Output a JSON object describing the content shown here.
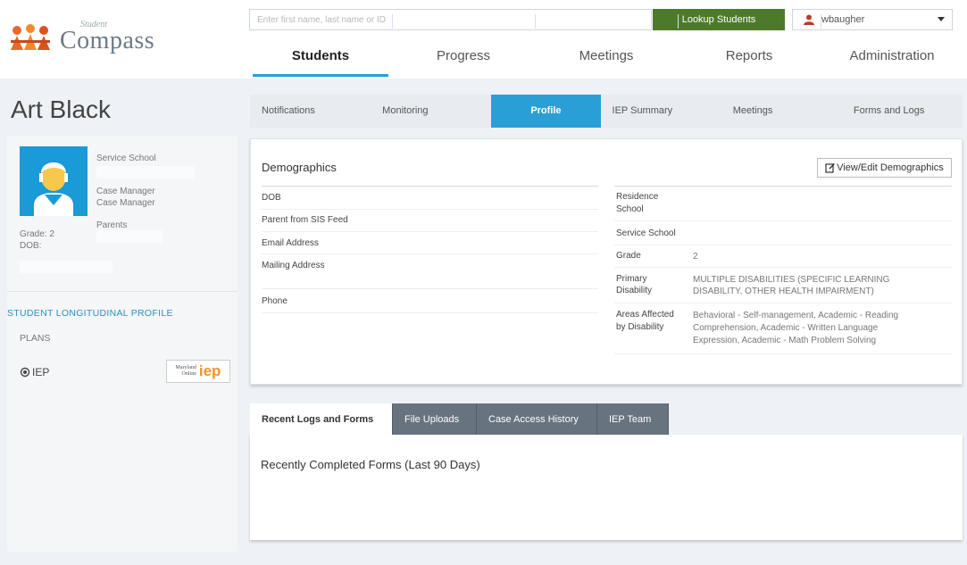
{
  "app": {
    "logo_small": "Student",
    "logo_big": "Compass"
  },
  "search": {
    "placeholder": "Enter first name, last name or ID",
    "button": "Lookup Students"
  },
  "user": {
    "name": "wbaugher"
  },
  "main_nav": [
    "Students",
    "Progress",
    "Meetings",
    "Reports",
    "Administration"
  ],
  "student": {
    "name": "Art Black",
    "service_school_label": "Service School",
    "case_manager_label": "Case Manager",
    "case_manager_value": "Case Manager",
    "parents_label": "Parents",
    "grade_label": "Grade: 2",
    "dob_label": "DOB:"
  },
  "sidebar": {
    "longitudinal_link": "STUDENT LONGITUDINAL PROFILE",
    "plans_label": "PLANS",
    "iep_label": "IEP",
    "iep_logo_text_a": "Maryland",
    "iep_logo_text_b": "Online",
    "iep_logo_text_c": "iep"
  },
  "sub_nav": [
    "Notifications",
    "Monitoring",
    "Profile",
    "IEP Summary",
    "Meetings",
    "Forms and Logs"
  ],
  "demographics": {
    "title": "Demographics",
    "edit_button": "View/Edit Demographics",
    "left_fields": [
      "DOB",
      "Parent from SIS Feed",
      "Email Address",
      "Mailing Address",
      "Phone"
    ],
    "residence_school_label_1": "Residence",
    "residence_school_label_2": "School",
    "service_school_label": "Service School",
    "grade_label": "Grade",
    "grade_value": "2",
    "primary_disability_label_1": "Primary",
    "primary_disability_label_2": "Disability",
    "primary_disability_value_1": "MULTIPLE DISABILITIES (SPECIFIC LEARNING",
    "primary_disability_value_2": "DISABILITY, OTHER HEALTH IMPAIRMENT)",
    "areas_label_1": "Areas Affected",
    "areas_label_2": "by Disability",
    "areas_value_1": "Behavioral - Self-management, Academic - Reading",
    "areas_value_2": "Comprehension, Academic - Written Language",
    "areas_value_3": "Expression, Academic - Math Problem Solving"
  },
  "bottom_tabs": [
    "Recent Logs and Forms",
    "File Uploads",
    "Case Access History",
    "IEP Team"
  ],
  "recent": {
    "title": "Recently Completed Forms (Last 90 Days)"
  },
  "colors": {
    "accent": "#2a9fd6",
    "lookup_green": "#4c7a2a",
    "tab_gray": "#67737e",
    "band": "#eef1f5"
  }
}
